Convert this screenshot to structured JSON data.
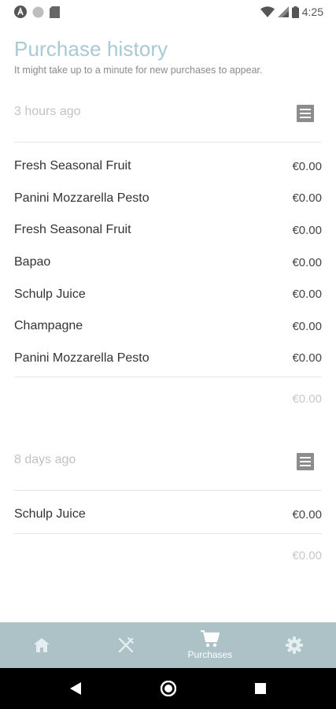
{
  "status_bar": {
    "time": "4:25",
    "left_icons": [
      "app-badge-icon",
      "circle-dot-icon",
      "sd-card-icon"
    ],
    "right_icons": [
      "wifi-icon",
      "cell-signal-icon",
      "battery-icon"
    ]
  },
  "page": {
    "title": "Purchase history",
    "subtitle": "It might take up to a minute for new purchases to appear."
  },
  "groups": [
    {
      "time": "3 hours ago",
      "icon": "receipt-icon",
      "items": [
        {
          "name": "Fresh Seasonal Fruit",
          "price": "€0.00"
        },
        {
          "name": "Panini Mozzarella Pesto",
          "price": "€0.00"
        },
        {
          "name": "Fresh Seasonal Fruit",
          "price": "€0.00"
        },
        {
          "name": "Bapao",
          "price": "€0.00"
        },
        {
          "name": "Schulp Juice",
          "price": "€0.00"
        },
        {
          "name": "Champagne",
          "price": "€0.00"
        },
        {
          "name": "Panini Mozzarella Pesto",
          "price": "€0.00"
        }
      ],
      "total": "€0.00"
    },
    {
      "time": "8 days ago",
      "icon": "receipt-icon",
      "items": [
        {
          "name": "Schulp Juice",
          "price": "€0.00"
        }
      ],
      "total": "€0.00"
    }
  ],
  "bottom_nav": {
    "items": [
      {
        "icon": "home-icon",
        "label": ""
      },
      {
        "icon": "fork-knife-icon",
        "label": ""
      },
      {
        "icon": "cart-icon",
        "label": "Purchases",
        "active": true
      },
      {
        "icon": "gear-icon",
        "label": ""
      }
    ],
    "background": "#adc2c7"
  },
  "colors": {
    "title": "#a9c9d3",
    "muted": "#c2c2c2"
  }
}
